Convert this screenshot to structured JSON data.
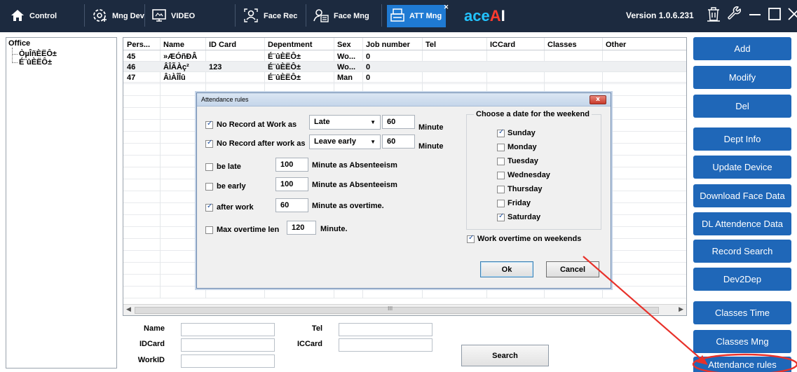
{
  "colors": {
    "topbar": "#1c2a3f",
    "active_tab": "#1f7ad3",
    "action_button": "#1f67b8",
    "annotation": "#e8312a"
  },
  "topbar": {
    "tabs": [
      {
        "label": "Control",
        "icon": "home-icon"
      },
      {
        "label": "Mng Dev",
        "icon": "device-settings-icon"
      },
      {
        "label": "VIDEO",
        "icon": "monitor-icon"
      },
      {
        "label": "Face Rec",
        "icon": "person-icon"
      },
      {
        "label": "Face Mng",
        "icon": "face-manage-icon"
      },
      {
        "label": "ATT Mng",
        "icon": "attendance-icon",
        "active": true
      }
    ],
    "brand_part1": "ace",
    "brand_part2": "A",
    "brand_part3": "I",
    "version": "Version 1.0.6.231",
    "window_icons": [
      "trash-icon",
      "wrench-icon",
      "minimize-icon",
      "maximize-icon",
      "close-icon"
    ]
  },
  "tree": {
    "root": "Office",
    "children": [
      "ÒµÎñÈËÔ±",
      "É¨ûÈËÔ±"
    ]
  },
  "grid": {
    "columns": [
      "Pers...",
      "Name",
      "ID Card",
      "Depentment",
      "Sex",
      "Job number",
      "Tel",
      "ICCard",
      "Classes",
      "Other"
    ],
    "rows": [
      {
        "pers": "45",
        "name": "»ÆÓñÐÂ",
        "id_card": "",
        "dept": "É¨ûÈËÔ±",
        "sex": "Wo...",
        "job": "0"
      },
      {
        "pers": "46",
        "name": "ÂÎÃÀç²",
        "id_card": "123",
        "dept": "É¨ûÈËÔ±",
        "sex": "Wo...",
        "job": "0"
      },
      {
        "pers": "47",
        "name": "ÂìÀÎÎû",
        "id_card": "",
        "dept": "É¨ûÈËÔ±",
        "sex": "Man",
        "job": "0"
      }
    ],
    "scroll_center": "III"
  },
  "search": {
    "name_label": "Name",
    "idcard_label": "IDCard",
    "workid_label": "WorkID",
    "tel_label": "Tel",
    "iccard_label": "ICCard",
    "button": "Search"
  },
  "actions": [
    "Add",
    "Modify",
    "Del",
    "Dept Info",
    "Update Device",
    "Download Face Data",
    "DL Attendence Data",
    "Record Search",
    "Dev2Dep",
    "Classes Time",
    "Classes Mng",
    "Attendance rules"
  ],
  "dialog": {
    "title": "Attendance rules",
    "close": "x",
    "no_record_work": {
      "label": "No Record at Work as",
      "checked": true,
      "select": "Late",
      "value": "60",
      "unit": "Minute"
    },
    "no_record_after": {
      "label": "No Record after work as",
      "checked": true,
      "select": "Leave early",
      "value": "60",
      "unit": "Minute"
    },
    "be_late": {
      "label": "be late",
      "checked": false,
      "value": "100",
      "suffix": "Minute as Absenteeism"
    },
    "be_early": {
      "label": "be early",
      "checked": false,
      "value": "100",
      "suffix": "Minute as Absenteeism"
    },
    "after_work": {
      "label": "after work",
      "checked": true,
      "value": "60",
      "suffix": "Minute as overtime."
    },
    "max_overtime": {
      "label": "Max overtime len",
      "checked": false,
      "value": "120",
      "suffix": "Minute."
    },
    "weekend_group": "Choose a date for the weekend",
    "days": [
      {
        "label": "Sunday",
        "checked": true
      },
      {
        "label": "Monday",
        "checked": false
      },
      {
        "label": "Tuesday",
        "checked": false
      },
      {
        "label": "Wednesday",
        "checked": false
      },
      {
        "label": "Thursday",
        "checked": false
      },
      {
        "label": "Friday",
        "checked": false
      },
      {
        "label": "Saturday",
        "checked": true
      }
    ],
    "weekend_overtime": {
      "label": "Work overtime on weekends",
      "checked": true
    },
    "ok": "Ok",
    "cancel": "Cancel"
  }
}
